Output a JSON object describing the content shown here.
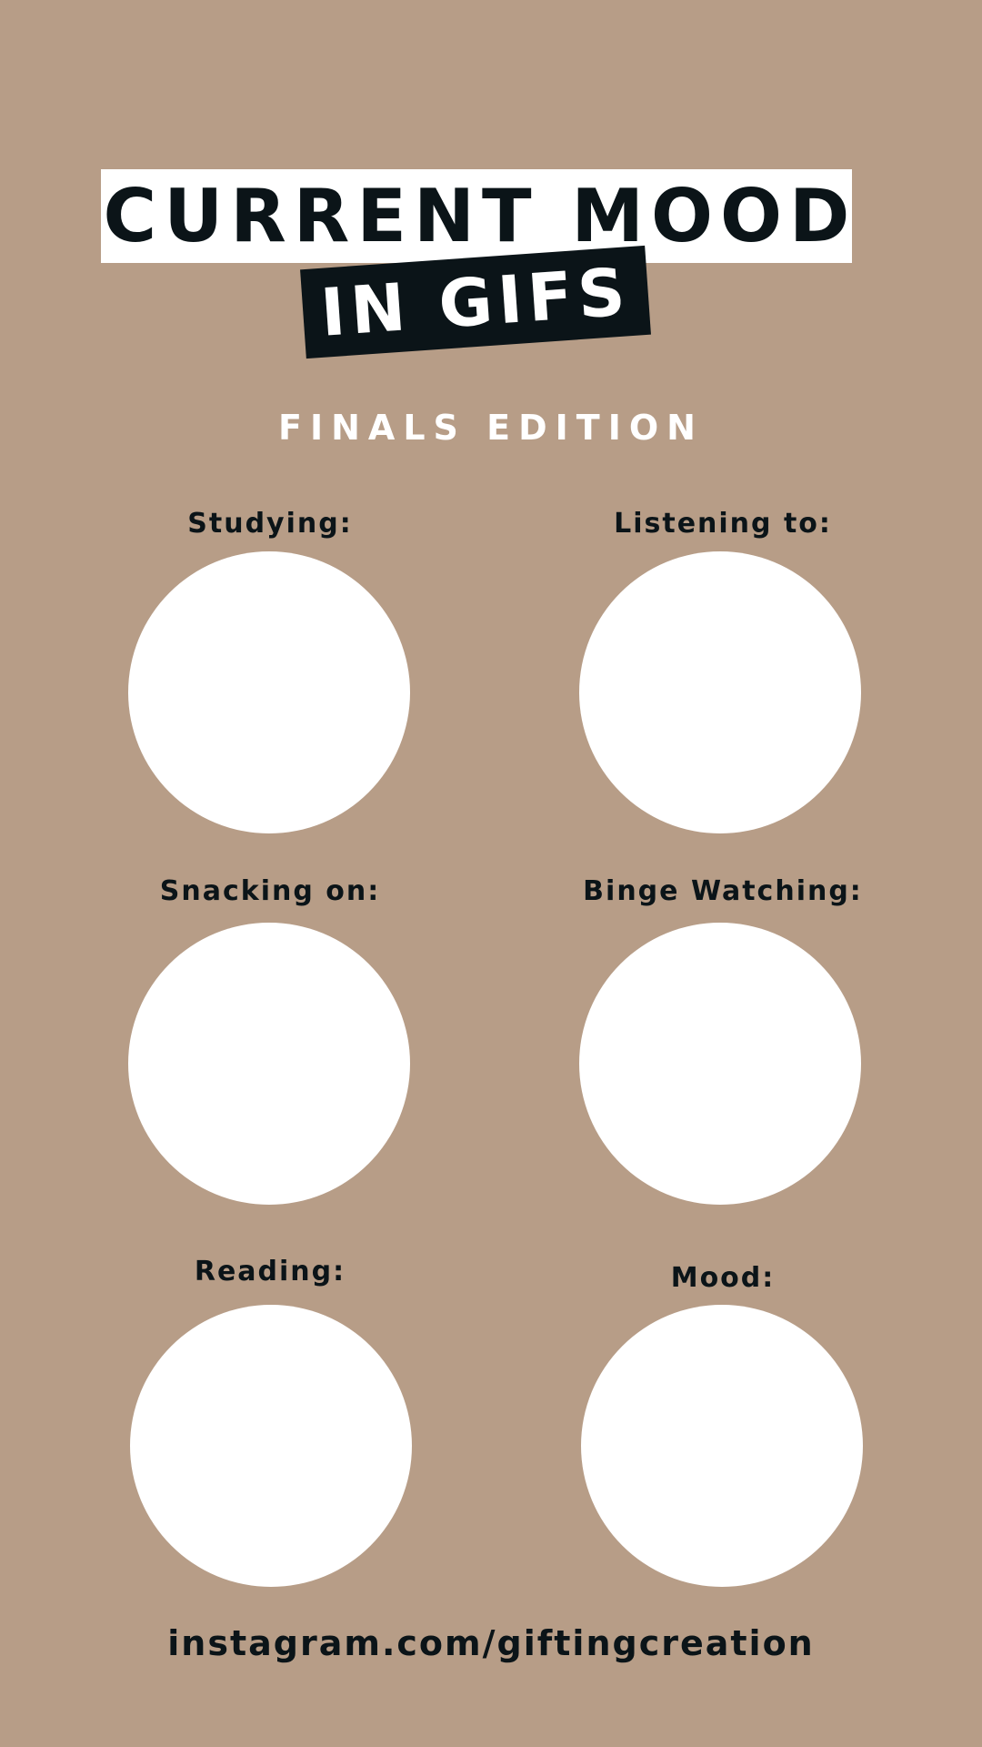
{
  "header": {
    "title": "CURRENT MOOD",
    "subtitle": "IN GIFS",
    "edition": "FINALS EDITION"
  },
  "slots": [
    {
      "label": "Studying:"
    },
    {
      "label": "Listening to:"
    },
    {
      "label": "Snacking on:"
    },
    {
      "label": "Binge Watching:"
    },
    {
      "label": "Reading:"
    },
    {
      "label": "Mood:"
    }
  ],
  "footer": {
    "link": "instagram.com/giftingcreation"
  },
  "colors": {
    "background": "#b79d87",
    "dark": "#0b1418",
    "light": "#ffffff"
  }
}
